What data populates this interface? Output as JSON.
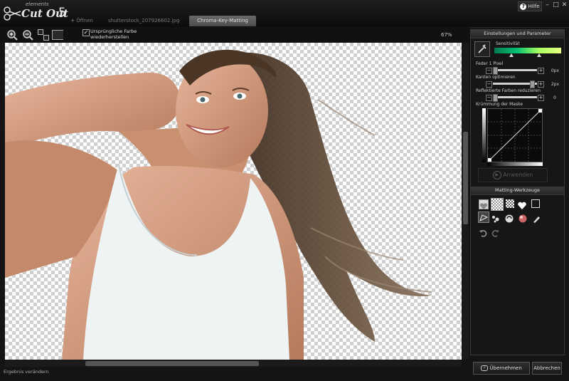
{
  "app": {
    "elements_label": "elements",
    "title": "Cut Out",
    "version": "5"
  },
  "tabs": [
    {
      "label": "Öffnen",
      "prefix": "+"
    },
    {
      "label": "shutterstock_207926602.jpg"
    },
    {
      "label": "Chroma-Key-Matting"
    }
  ],
  "window": {
    "help_label": "Hilfe",
    "help_glyph": "?",
    "minimize": "–",
    "maximize": "□",
    "close": "✕"
  },
  "toolbar": {
    "restore_label": "Ursprüngliche Farbe wiederherstellen",
    "restore_checked": true,
    "zoom": "67%"
  },
  "panel": {
    "settings_header": "Einstellungen und Parameter",
    "sensitivity_label": "Sensitivität",
    "feather_label": "Feder 1 Pixel",
    "feather_value": "0px",
    "edges_label": "Kanten optimieren",
    "edges_value": "2px",
    "reflect_label": "Reflektierte Farben reduzieren",
    "reflect_value": "0",
    "mask_curve_label": "Krümmung der Maske",
    "apply_label": "Anwenden",
    "matting_header": "Matting-Werkzeuge"
  },
  "status": "Ergebnis verändern",
  "buttons": {
    "accept": "Übernehmen",
    "cancel": "Abbrechen"
  },
  "colors": {
    "active_tab": "#5a5a5a",
    "background": "#141414",
    "sensitivity_start": "#00b060",
    "sensitivity_end": "#e8ff60"
  },
  "icons": [
    "zoom-in-icon",
    "zoom-out-icon",
    "fit-view-icon",
    "full-view-icon",
    "eyedropper-icon",
    "heart-icon",
    "checker-icon",
    "brush-icon",
    "undo-icon",
    "redo-icon"
  ]
}
